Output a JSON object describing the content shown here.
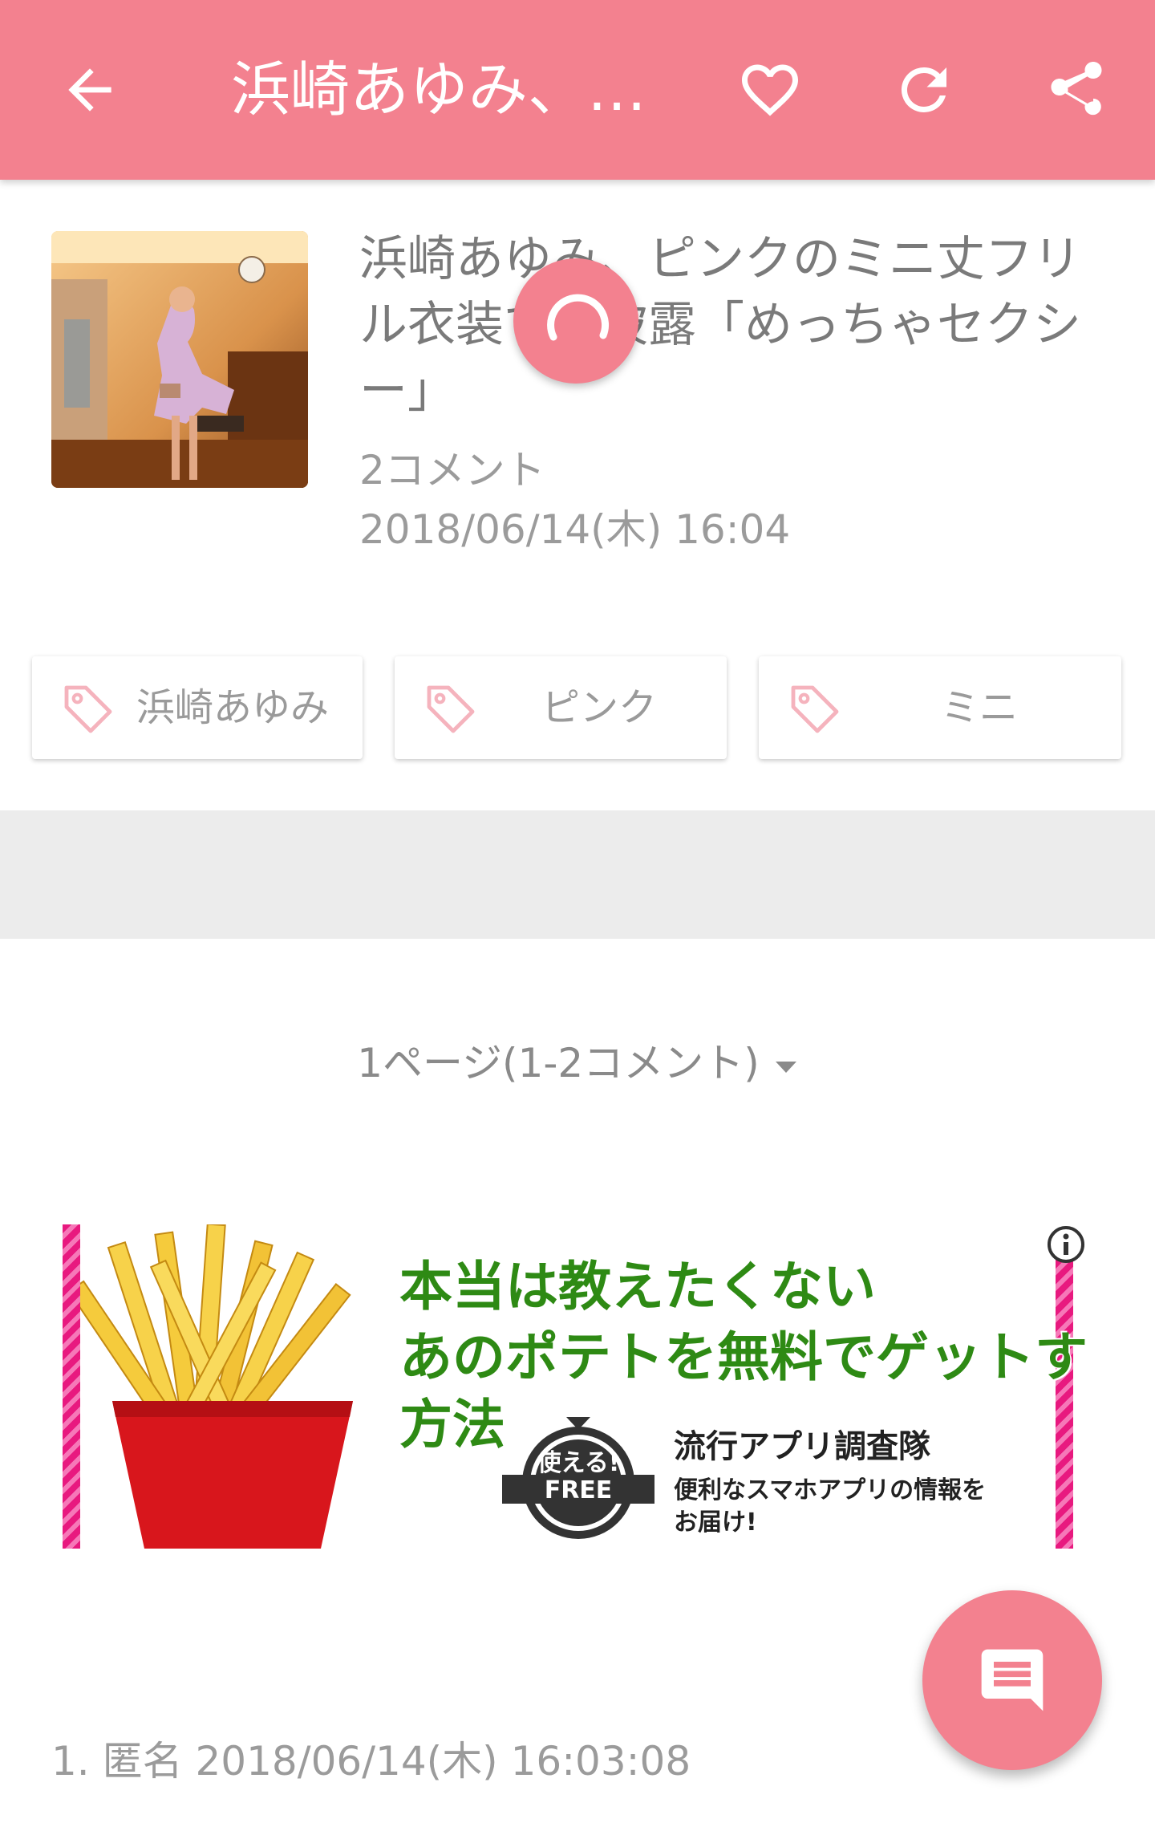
{
  "header": {
    "title": "浜崎あゆみ、…",
    "back_icon": "arrow-left-icon",
    "actions": [
      "heart-icon",
      "refresh-icon",
      "share-icon"
    ],
    "color": "#f3818f"
  },
  "article": {
    "title": "浜崎あゆみ、ピンクのミニ丈フリル衣装で脚披露「めっちゃセクシー」",
    "comments": "2コメント",
    "datetime": "2018/06/14(木) 16:04"
  },
  "tags": [
    {
      "label": "浜崎あゆみ"
    },
    {
      "label": "ピンク"
    },
    {
      "label": "ミニ"
    }
  ],
  "pager": {
    "label": "1ページ(1-2コメント)"
  },
  "ad": {
    "line1": "本当は教えたくない",
    "line2": "あのポテトを無料でゲットする",
    "line3": "方法",
    "badge_top": "使える!",
    "badge_main": "FREE",
    "brand": "流行アプリ調査隊",
    "sub1": "便利なスマホアプリの情報を",
    "sub2": "お届け!"
  },
  "comment": {
    "first_line": "1. 匿名 2018/06/14(木) 16:03:08"
  },
  "fab": {
    "icon": "comment-icon"
  }
}
